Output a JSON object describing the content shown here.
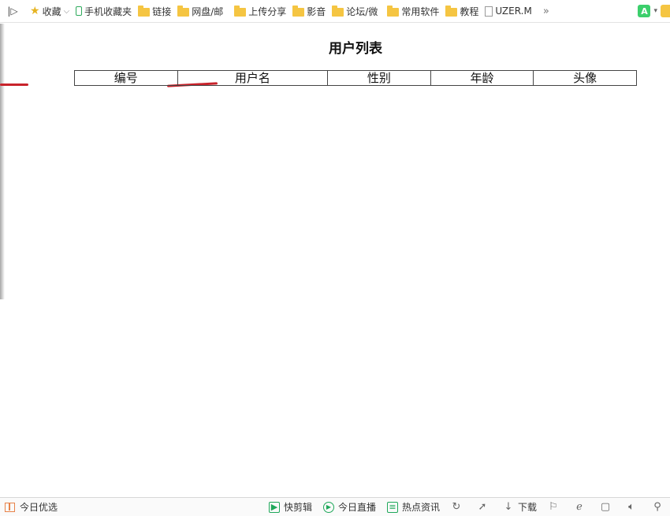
{
  "bookmarks_bar": {
    "sidebar_toggle": "|▷",
    "items": [
      {
        "label": "收藏",
        "icon": "star-icon"
      },
      {
        "label": "手机收藏夹",
        "icon": "phone-icon"
      },
      {
        "label": "链接",
        "icon": "folder-icon"
      },
      {
        "label": "网盘/邮",
        "icon": "folder-icon"
      },
      {
        "label": "上传分享",
        "icon": "folder-icon"
      },
      {
        "label": "影音",
        "icon": "folder-icon"
      },
      {
        "label": "论坛/微",
        "icon": "folder-icon"
      },
      {
        "label": "常用软件",
        "icon": "folder-icon"
      },
      {
        "label": "教程",
        "icon": "folder-icon"
      },
      {
        "label": "UZER.M",
        "icon": "page-icon"
      }
    ],
    "more": "»",
    "extension_label": "A"
  },
  "page": {
    "title": "用户列表",
    "table": {
      "columns": [
        "编号",
        "用户名",
        "性别",
        "年龄",
        "头像"
      ]
    }
  },
  "status_bar": {
    "left_label": "今日优选",
    "items": [
      {
        "label": "快剪辑",
        "icon": "play-box-icon"
      },
      {
        "label": "今日直播",
        "icon": "play-circle-icon"
      },
      {
        "label": "热点资讯",
        "icon": "news-icon"
      },
      {
        "label": "",
        "icon": "refresh-icon"
      },
      {
        "label": "",
        "icon": "rocket-icon"
      },
      {
        "label": "下载",
        "icon": "download-icon"
      },
      {
        "label": "",
        "icon": "flag-icon"
      },
      {
        "label": "",
        "icon": "ie-icon"
      },
      {
        "label": "",
        "icon": "window-icon"
      },
      {
        "label": "",
        "icon": "speaker-icon"
      },
      {
        "label": "",
        "icon": "zoom-icon"
      }
    ]
  },
  "colors": {
    "folder": "#f5c542",
    "accent_green": "#1fa85a",
    "red_mark": "#c8232b",
    "table_border": "#444444"
  }
}
